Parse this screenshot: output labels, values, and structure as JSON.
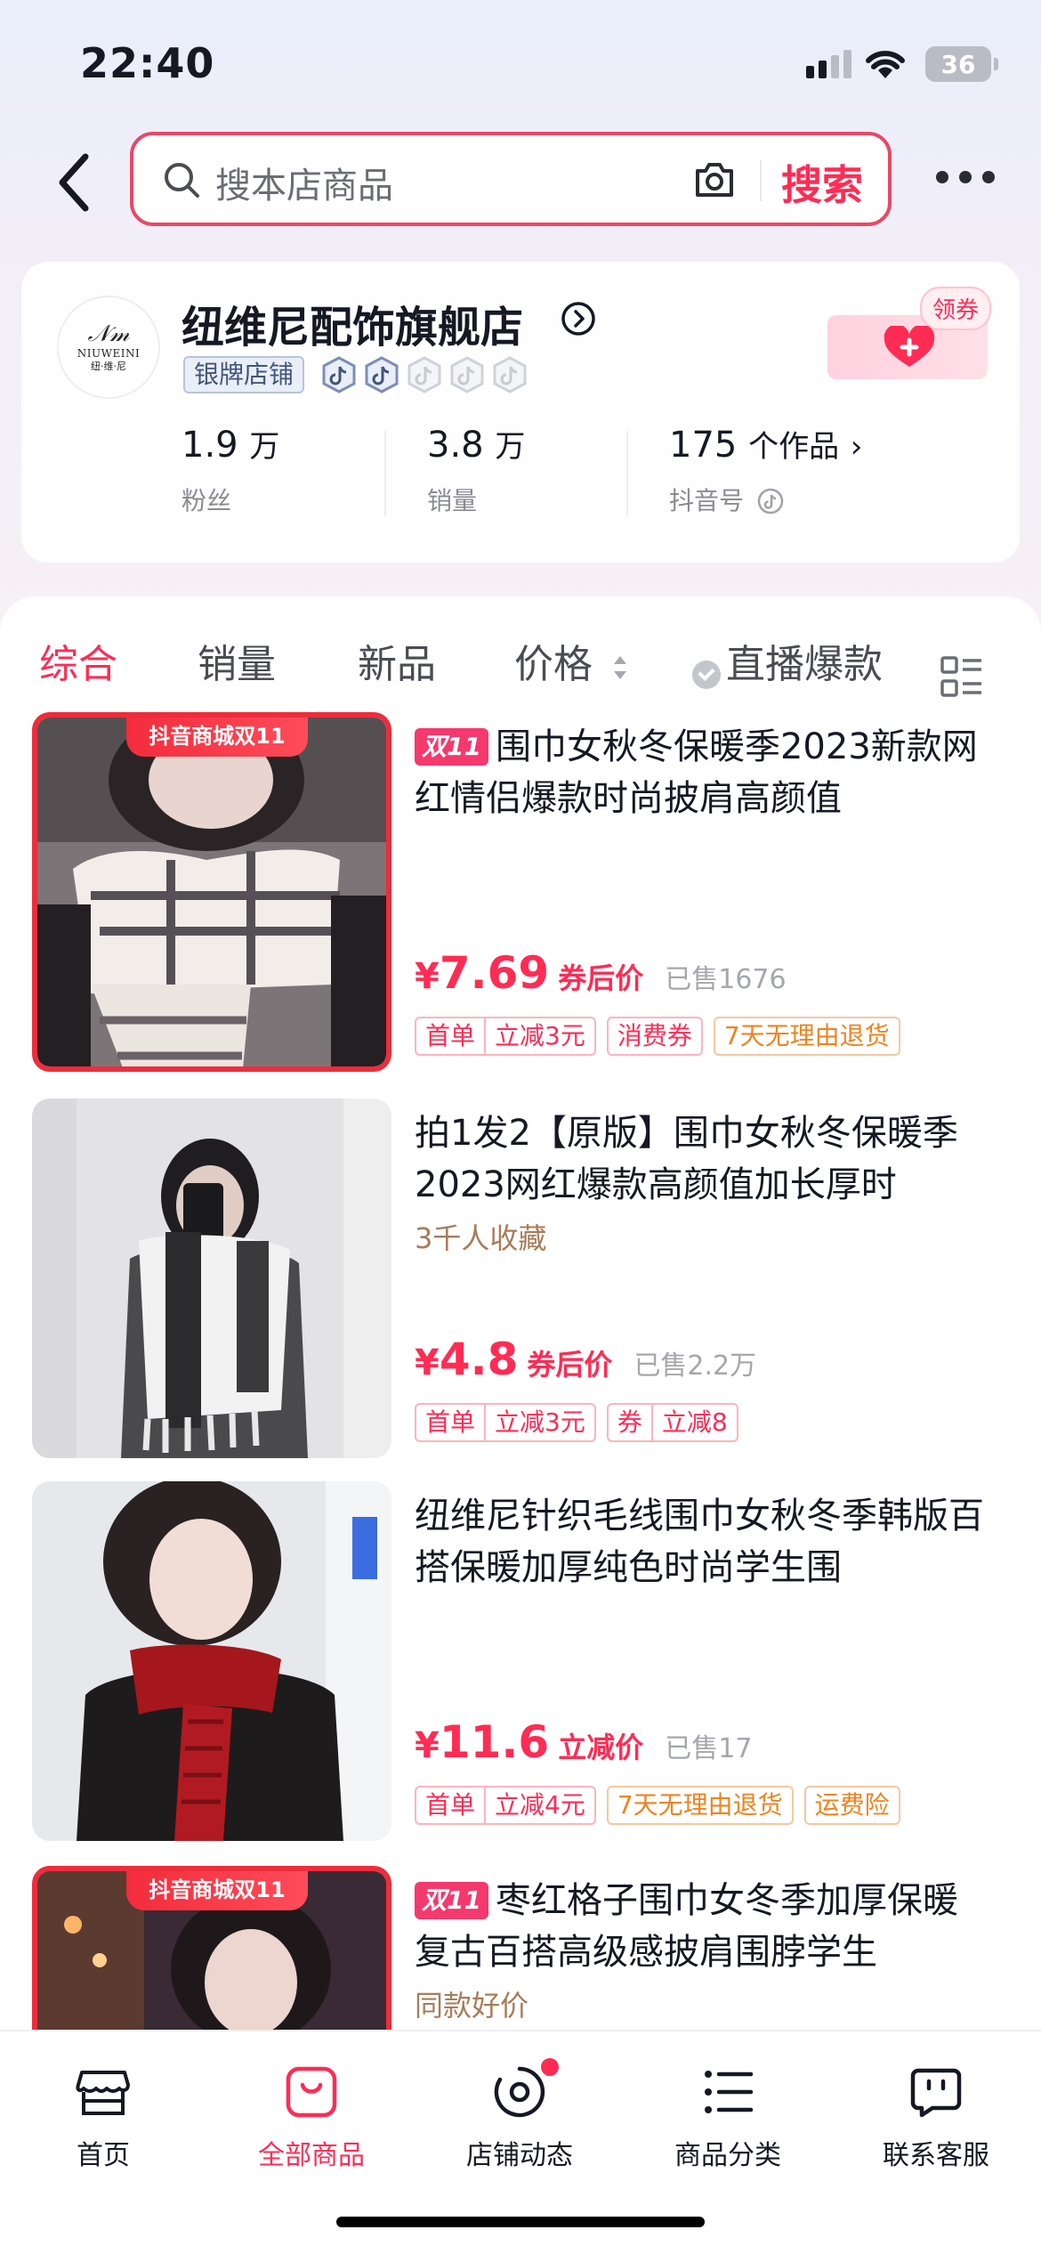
{
  "status": {
    "time": "22:40",
    "battery": "36"
  },
  "search": {
    "placeholder": "搜本店商品",
    "button": "搜索"
  },
  "shop": {
    "logo_text": "NIUWEINI",
    "logo_sub": "纽·维·尼",
    "name": "纽维尼配饰旗舰店",
    "badge": "银牌店铺",
    "coupon": "领券",
    "stats": [
      {
        "value": "1.9",
        "unit": "万",
        "label": "粉丝"
      },
      {
        "value": "3.8",
        "unit": "万",
        "label": "销量"
      },
      {
        "value": "175",
        "unit": "个作品",
        "label": "抖音号"
      }
    ]
  },
  "tabs": [
    "综合",
    "销量",
    "新品",
    "价格",
    "直播爆款"
  ],
  "colors": {
    "accent": "#fe2c55",
    "sale_red": "#ee2c3c",
    "tag_orange": "#f08320"
  },
  "products": [
    {
      "banner": "抖音商城双11",
      "badge": "双11",
      "title": "围巾女秋冬保暖季2023新款网红情侣爆款时尚披肩高颜值",
      "subtitle": "",
      "currency": "¥",
      "price": "7.69",
      "price_label": "券后价",
      "sold": "已售1676",
      "tags": [
        [
          "首单",
          "立减3元"
        ],
        [
          "消费券"
        ],
        [
          "7天无理由退货"
        ]
      ]
    },
    {
      "banner": "",
      "badge": "",
      "title": "拍1发2【原版】围巾女秋冬保暖季2023网红爆款高颜值加长厚时",
      "subtitle": "3千人收藏",
      "currency": "¥",
      "price": "4.8",
      "price_label": "券后价",
      "sold": "已售2.2万",
      "tags": [
        [
          "首单",
          "立减3元"
        ],
        [
          "券",
          "立减8"
        ]
      ]
    },
    {
      "banner": "",
      "badge": "",
      "title": "纽维尼针织毛线围巾女秋冬季韩版百搭保暖加厚纯色时尚学生围",
      "subtitle": "",
      "currency": "¥",
      "price": "11.6",
      "price_label": "立减价",
      "sold": "已售17",
      "tags": [
        [
          "首单",
          "立减4元"
        ],
        [
          "7天无理由退货"
        ],
        [
          "运费险"
        ]
      ]
    },
    {
      "banner": "抖音商城双11",
      "badge": "双11",
      "title": "枣红格子围巾女冬季加厚保暖复古百搭高级感披肩围脖学生",
      "subtitle": "同款好价"
    }
  ],
  "nav": [
    {
      "label": "首页",
      "icon": "store-icon"
    },
    {
      "label": "全部商品",
      "icon": "bag-icon"
    },
    {
      "label": "店铺动态",
      "icon": "dynamic-icon"
    },
    {
      "label": "商品分类",
      "icon": "category-icon"
    },
    {
      "label": "联系客服",
      "icon": "service-icon"
    }
  ]
}
